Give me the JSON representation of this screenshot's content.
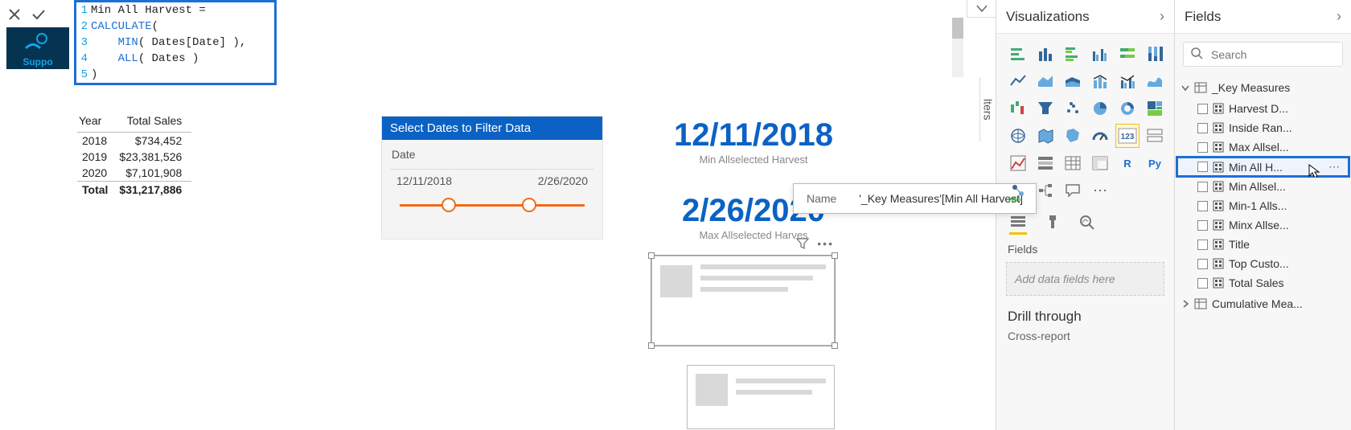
{
  "formula": {
    "lines": [
      {
        "n": "1",
        "pre": "",
        "kw": "",
        "post": "Min All Harvest ="
      },
      {
        "n": "2",
        "pre": "",
        "kw": "CALCULATE",
        "post": "("
      },
      {
        "n": "3",
        "pre": "    ",
        "kw": "MIN",
        "post": "( Dates[Date] ),"
      },
      {
        "n": "4",
        "pre": "    ",
        "kw": "ALL",
        "post": "( Dates )"
      },
      {
        "n": "5",
        "pre": "",
        "kw": "",
        "post": ")"
      }
    ]
  },
  "support_badge": "Suppo",
  "table": {
    "headers": [
      "Year",
      "Total Sales"
    ],
    "rows": [
      {
        "year": "2018",
        "sales": "$734,452"
      },
      {
        "year": "2019",
        "sales": "$23,381,526"
      },
      {
        "year": "2020",
        "sales": "$7,101,908"
      }
    ],
    "total_label": "Total",
    "total_value": "$31,217,886"
  },
  "slicer": {
    "title": "Select Dates to Filter Data",
    "field": "Date",
    "from": "12/11/2018",
    "to": "2/26/2020"
  },
  "cards": {
    "min": {
      "value": "12/11/2018",
      "caption": "Min Allselected Harvest"
    },
    "max": {
      "value": "2/26/2020",
      "caption": "Max Allselected Harves"
    }
  },
  "tooltip": {
    "label": "Name",
    "value": "'_Key Measures'[Min All Harvest]"
  },
  "filters_tab": "lters",
  "viz": {
    "title": "Visualizations",
    "fields_label": "Fields",
    "well_placeholder": "Add data fields here",
    "drill_title": "Drill through",
    "drill_sub": "Cross-report"
  },
  "fields": {
    "title": "Fields",
    "search_placeholder": "Search",
    "tables": [
      {
        "name": "_Key Measures",
        "expanded": true,
        "items": [
          {
            "label": "Harvest D..."
          },
          {
            "label": "Inside Ran..."
          },
          {
            "label": "Max Allsel..."
          },
          {
            "label": "Min All H...",
            "highlight": true
          },
          {
            "label": "Min Allsel..."
          },
          {
            "label": "Min-1 Alls..."
          },
          {
            "label": "Minx Allse..."
          },
          {
            "label": "Title"
          },
          {
            "label": "Top Custo..."
          },
          {
            "label": "Total Sales"
          }
        ]
      },
      {
        "name": "Cumulative Mea...",
        "expanded": false,
        "items": []
      }
    ]
  }
}
